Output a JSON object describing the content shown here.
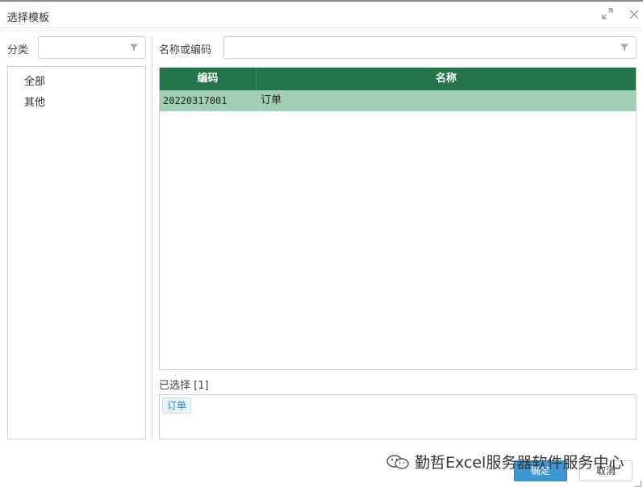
{
  "dialog": {
    "title": "选择模板",
    "maximize_icon": "maximize-icon",
    "close_icon": "close-icon"
  },
  "category": {
    "label": "分类",
    "filter_value": "",
    "filter_icon": "filter-icon",
    "items": [
      "全部",
      "其他"
    ]
  },
  "search": {
    "label": "名称或编码",
    "value": "",
    "filter_icon": "filter-icon"
  },
  "grid": {
    "columns": [
      "编码",
      "名称"
    ],
    "rows": [
      {
        "code": "20220317001",
        "name": "订单",
        "selected": true
      }
    ],
    "header_color": "#24744a",
    "selected_row_color": "#a2cfb3"
  },
  "selection": {
    "label": "已选择 [1]",
    "tags": [
      "订单"
    ]
  },
  "footer": {
    "ok_label": "确定",
    "cancel_label": "取消",
    "watermark_text": "勤哲Excel服务器软件服务中心",
    "watermark_icon": "wechat-icon"
  }
}
